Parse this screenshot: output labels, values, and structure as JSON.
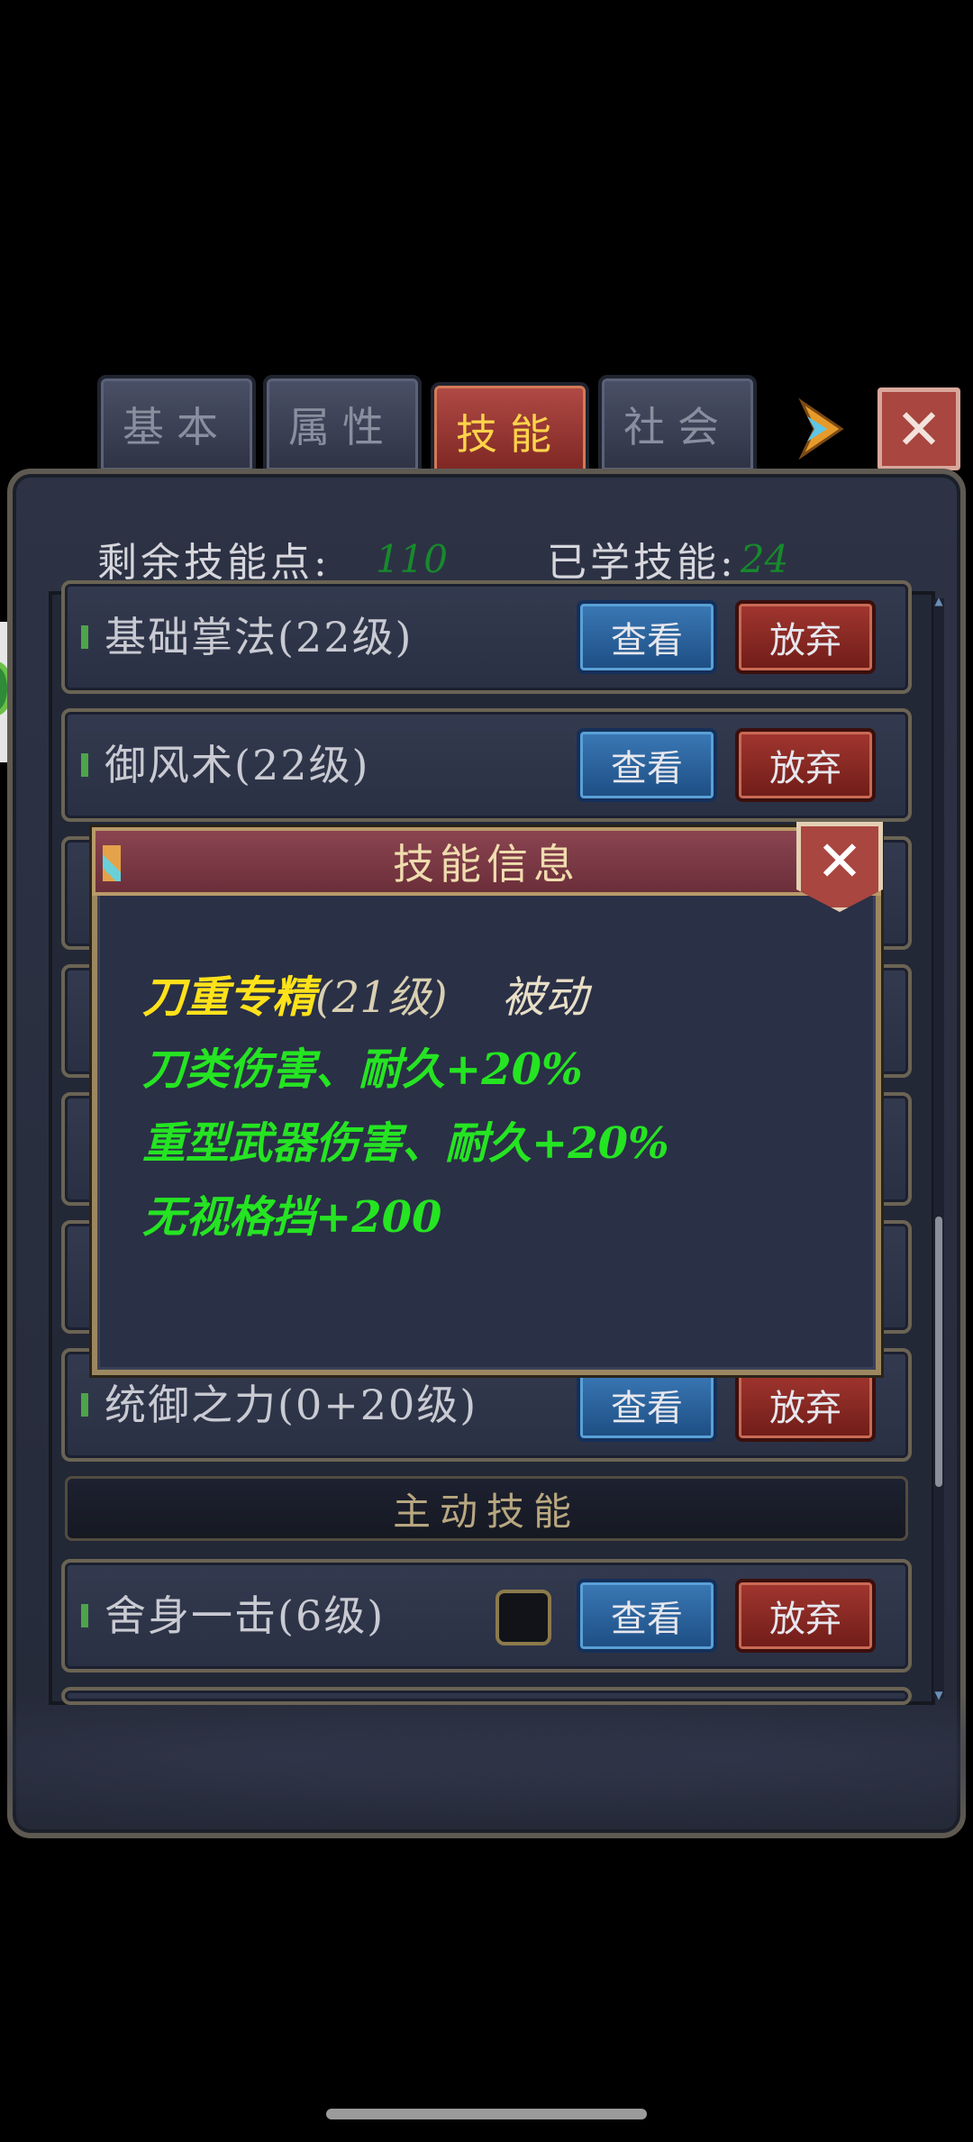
{
  "tabs": [
    {
      "label": "基本",
      "active": false
    },
    {
      "label": "属性",
      "active": false
    },
    {
      "label": "技能",
      "active": true
    },
    {
      "label": "社会",
      "active": false
    }
  ],
  "summary": {
    "remaining_label": "剩余技能点:",
    "remaining_value": "110",
    "learned_label": "已学技能:",
    "learned_value": "24"
  },
  "skills": [
    {
      "name": "基础掌法(22级)",
      "view": "查看",
      "drop": "放弃"
    },
    {
      "name": "御风术(22级)",
      "view": "查看",
      "drop": "放弃"
    },
    {
      "name": "统御之力(0+20级)",
      "view": "查看",
      "drop": "放弃"
    }
  ],
  "section_active": "主动技能",
  "active_skill": {
    "name": "舍身一击(6级)",
    "view": "查看",
    "drop": "放弃"
  },
  "dialog": {
    "title": "技能信息",
    "skill_name": "刀重专精",
    "skill_level": "(21级)",
    "skill_type": "被动",
    "effects": [
      "刀类伤害、耐久+20%",
      "重型武器伤害、耐久+20%",
      "无视格挡+200"
    ]
  },
  "colors": {
    "accent_active_tab": "#ffd34a",
    "points_value": "#178a2c",
    "effect_text": "#25e422",
    "skill_name_text": "#ffe21a"
  }
}
